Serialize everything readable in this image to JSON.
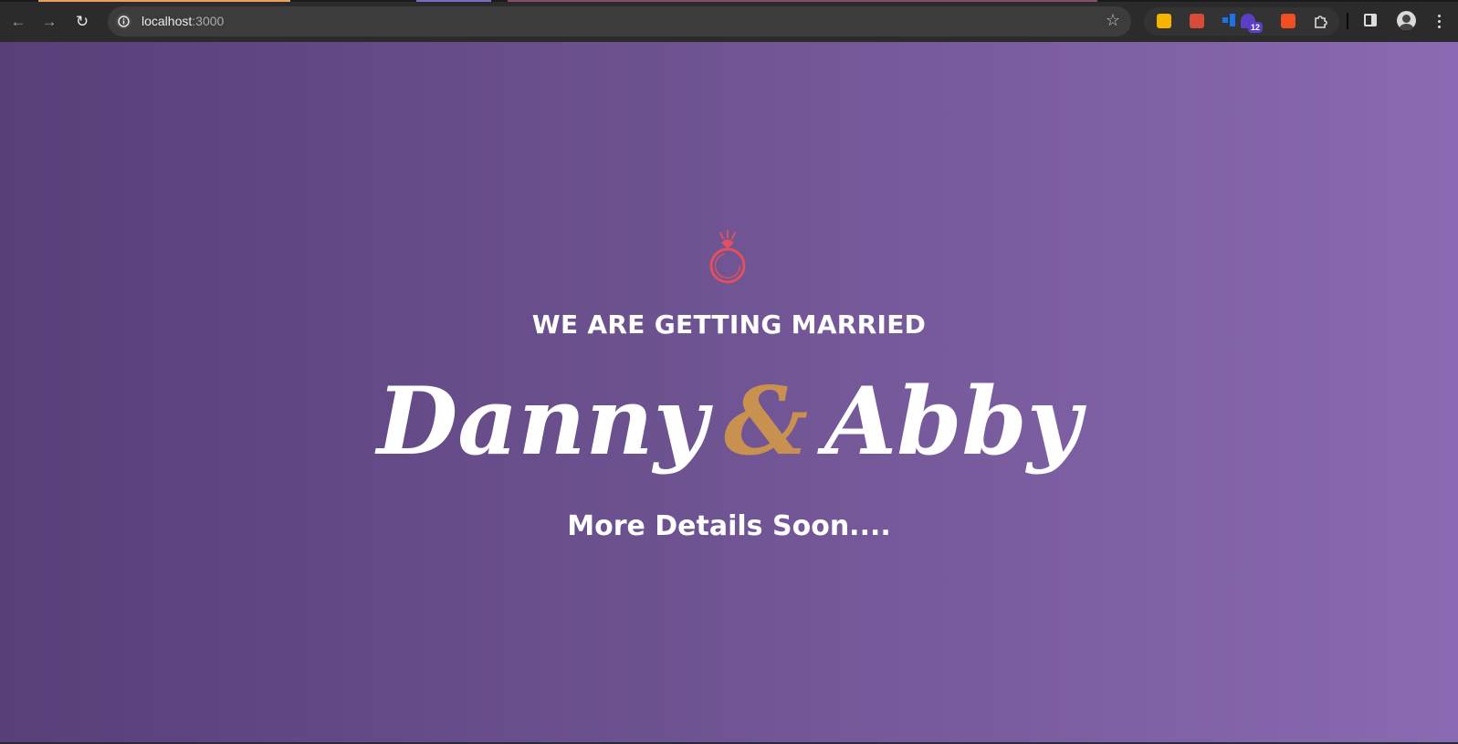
{
  "browser": {
    "url_host": "localhost",
    "url_port": ":3000",
    "back_icon": "arrow-left-icon",
    "forward_icon": "arrow-right-icon",
    "reload_icon": "reload-icon",
    "bookmark_icon": "star-icon",
    "extensions": [
      {
        "name": "keep-extension-icon",
        "color": "#f5b400"
      },
      {
        "name": "gift-extension-icon",
        "color": "#d94a3a"
      },
      {
        "name": "trello-extension-icon",
        "color": "#1a73e8"
      },
      {
        "name": "hat-extension-icon",
        "color": "#5b3fc9",
        "badge": "12"
      },
      {
        "name": "percent-extension-icon",
        "color": "#f04e23"
      }
    ]
  },
  "page": {
    "icon": "ring-icon",
    "tagline": "WE ARE GETTING MARRIED",
    "name_one": "Danny",
    "ampersand": "&",
    "name_two": "Abby",
    "subline": "More Details Soon....",
    "colors": {
      "gradient_start": "#573f78",
      "gradient_end": "#8a6ab2",
      "accent": "#c9914f",
      "ring": "#e0505f",
      "text": "#ffffff"
    }
  }
}
